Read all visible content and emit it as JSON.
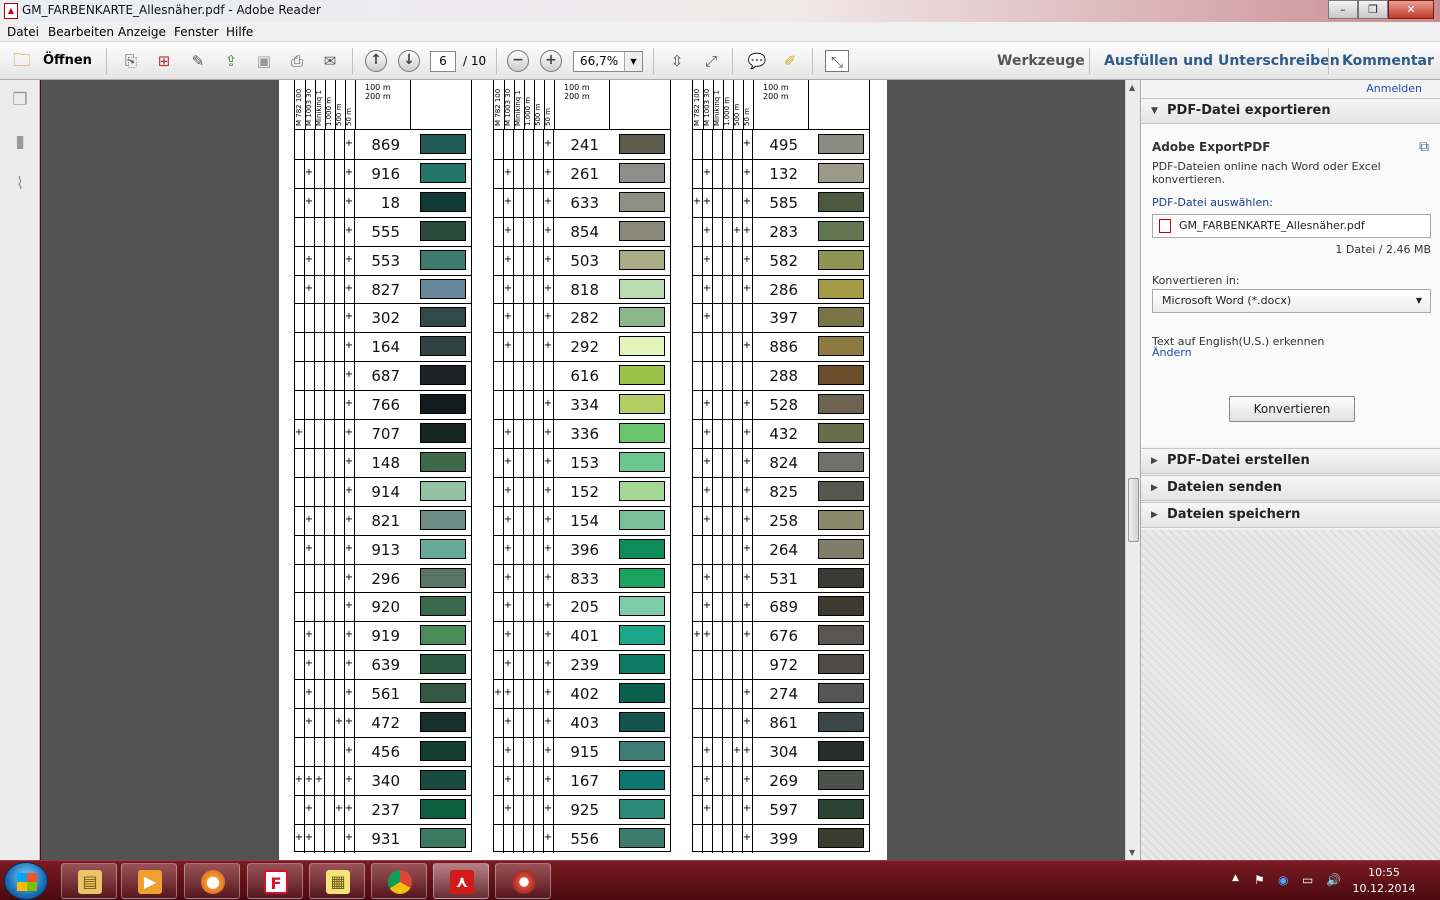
{
  "window": {
    "title": "GM_FARBENKARTE_Allesnäher.pdf - Adobe Reader"
  },
  "menu": [
    "Datei",
    "Bearbeiten",
    "Anzeige",
    "Fenster",
    "Hilfe"
  ],
  "toolbar": {
    "open_label": "Öffnen",
    "page_current": "6",
    "page_total": "/ 10",
    "zoom": "66,7%",
    "tools_label": "Werkzeuge",
    "fill_sign_label": "Ausfüllen und Unterschreiben",
    "comment_label": "Kommentar"
  },
  "document": {
    "column_headers": [
      "M 782 100",
      "M 1003 30",
      "Minikinq 1",
      "1.000 m",
      "500 m",
      "50 m"
    ],
    "meter_labels": [
      "100 m",
      "200 m"
    ],
    "columns": [
      {
        "rows": [
          {
            "num": "869",
            "color": "#1f5a57",
            "marks": [
              0,
              0,
              0,
              0,
              0,
              1
            ]
          },
          {
            "num": "916",
            "color": "#23756a",
            "marks": [
              0,
              1,
              0,
              0,
              0,
              1
            ]
          },
          {
            "num": "18",
            "color": "#0f3a36",
            "marks": [
              0,
              1,
              0,
              0,
              0,
              1
            ]
          },
          {
            "num": "555",
            "color": "#2a4b3e",
            "marks": [
              0,
              0,
              0,
              0,
              0,
              1
            ]
          },
          {
            "num": "553",
            "color": "#3d7b6e",
            "marks": [
              0,
              1,
              0,
              0,
              0,
              1
            ]
          },
          {
            "num": "827",
            "color": "#66889a",
            "marks": [
              0,
              1,
              0,
              0,
              0,
              1
            ]
          },
          {
            "num": "302",
            "color": "#2f4a48",
            "marks": [
              0,
              0,
              0,
              0,
              0,
              1
            ]
          },
          {
            "num": "164",
            "color": "#2f4344",
            "marks": [
              0,
              0,
              0,
              0,
              0,
              1
            ]
          },
          {
            "num": "687",
            "color": "#202326",
            "marks": [
              0,
              0,
              0,
              0,
              0,
              1
            ]
          },
          {
            "num": "766",
            "color": "#131a1d",
            "marks": [
              0,
              0,
              0,
              0,
              0,
              1
            ]
          },
          {
            "num": "707",
            "color": "#172622",
            "marks": [
              1,
              0,
              0,
              0,
              0,
              1
            ]
          },
          {
            "num": "148",
            "color": "#3f6a4a",
            "marks": [
              0,
              0,
              0,
              0,
              0,
              1
            ]
          },
          {
            "num": "914",
            "color": "#92c1a3",
            "marks": [
              0,
              0,
              0,
              0,
              0,
              1
            ]
          },
          {
            "num": "821",
            "color": "#6e8e85",
            "marks": [
              0,
              1,
              0,
              0,
              0,
              1
            ]
          },
          {
            "num": "913",
            "color": "#6aaa98",
            "marks": [
              0,
              1,
              0,
              0,
              0,
              1
            ]
          },
          {
            "num": "296",
            "color": "#587566",
            "marks": [
              0,
              0,
              0,
              0,
              0,
              1
            ]
          },
          {
            "num": "920",
            "color": "#3a6a4c",
            "marks": [
              0,
              0,
              0,
              0,
              0,
              1
            ]
          },
          {
            "num": "919",
            "color": "#4b8c5a",
            "marks": [
              0,
              1,
              0,
              0,
              0,
              1
            ]
          },
          {
            "num": "639",
            "color": "#2d5a43",
            "marks": [
              0,
              1,
              0,
              0,
              0,
              1
            ]
          },
          {
            "num": "561",
            "color": "#375745",
            "marks": [
              0,
              1,
              0,
              0,
              0,
              1
            ]
          },
          {
            "num": "472",
            "color": "#18302b",
            "marks": [
              0,
              1,
              0,
              0,
              1,
              1
            ]
          },
          {
            "num": "456",
            "color": "#113e2e",
            "marks": [
              0,
              0,
              0,
              0,
              0,
              1
            ]
          },
          {
            "num": "340",
            "color": "#1b4a40",
            "marks": [
              1,
              1,
              1,
              0,
              0,
              1
            ]
          },
          {
            "num": "237",
            "color": "#0b5e3f",
            "marks": [
              0,
              1,
              0,
              0,
              1,
              1
            ]
          },
          {
            "num": "931",
            "color": "#3b7963",
            "marks": [
              1,
              1,
              0,
              0,
              0,
              1
            ]
          }
        ]
      },
      {
        "rows": [
          {
            "num": "241",
            "color": "#5e5c4d",
            "marks": [
              0,
              0,
              0,
              0,
              0,
              1
            ]
          },
          {
            "num": "261",
            "color": "#8c8f8a",
            "marks": [
              0,
              1,
              0,
              0,
              0,
              1
            ]
          },
          {
            "num": "633",
            "color": "#8d8f82",
            "marks": [
              0,
              1,
              0,
              0,
              0,
              1
            ]
          },
          {
            "num": "854",
            "color": "#8a8a7a",
            "marks": [
              0,
              1,
              0,
              0,
              0,
              1
            ]
          },
          {
            "num": "503",
            "color": "#a9ad88",
            "marks": [
              0,
              1,
              0,
              0,
              0,
              1
            ]
          },
          {
            "num": "818",
            "color": "#b8dcb0",
            "marks": [
              0,
              1,
              0,
              0,
              0,
              1
            ]
          },
          {
            "num": "282",
            "color": "#8cb78a",
            "marks": [
              0,
              1,
              0,
              0,
              0,
              1
            ]
          },
          {
            "num": "292",
            "color": "#e4f3b9",
            "marks": [
              0,
              1,
              0,
              0,
              0,
              1
            ]
          },
          {
            "num": "616",
            "color": "#9cc24c",
            "marks": [
              0,
              0,
              0,
              0,
              0,
              0
            ]
          },
          {
            "num": "334",
            "color": "#b2cc66",
            "marks": [
              0,
              0,
              0,
              0,
              0,
              1
            ]
          },
          {
            "num": "336",
            "color": "#6ac46d",
            "marks": [
              0,
              1,
              0,
              0,
              0,
              1
            ]
          },
          {
            "num": "153",
            "color": "#6bc68f",
            "marks": [
              0,
              1,
              0,
              0,
              0,
              1
            ]
          },
          {
            "num": "152",
            "color": "#a6d895",
            "marks": [
              0,
              1,
              0,
              0,
              0,
              1
            ]
          },
          {
            "num": "154",
            "color": "#7ac19a",
            "marks": [
              0,
              1,
              0,
              0,
              0,
              1
            ]
          },
          {
            "num": "396",
            "color": "#0b8c58",
            "marks": [
              0,
              1,
              0,
              0,
              0,
              1
            ]
          },
          {
            "num": "833",
            "color": "#1aa35e",
            "marks": [
              0,
              1,
              0,
              0,
              0,
              1
            ]
          },
          {
            "num": "205",
            "color": "#7fccaa",
            "marks": [
              0,
              1,
              0,
              0,
              0,
              1
            ]
          },
          {
            "num": "401",
            "color": "#1da68a",
            "marks": [
              0,
              1,
              0,
              0,
              0,
              1
            ]
          },
          {
            "num": "239",
            "color": "#0b7c62",
            "marks": [
              0,
              1,
              0,
              0,
              0,
              1
            ]
          },
          {
            "num": "402",
            "color": "#0b5f4e",
            "marks": [
              1,
              1,
              0,
              0,
              0,
              1
            ]
          },
          {
            "num": "403",
            "color": "#15534f",
            "marks": [
              0,
              1,
              0,
              0,
              0,
              1
            ]
          },
          {
            "num": "915",
            "color": "#3f7c78",
            "marks": [
              0,
              1,
              0,
              0,
              0,
              1
            ]
          },
          {
            "num": "167",
            "color": "#0e7670",
            "marks": [
              0,
              1,
              0,
              0,
              0,
              1
            ]
          },
          {
            "num": "925",
            "color": "#2a8a76",
            "marks": [
              0,
              1,
              0,
              0,
              0,
              1
            ]
          },
          {
            "num": "556",
            "color": "#3d7d6e",
            "marks": [
              0,
              0,
              0,
              0,
              0,
              1
            ]
          }
        ]
      },
      {
        "rows": [
          {
            "num": "495",
            "color": "#8b8d83",
            "marks": [
              0,
              0,
              0,
              0,
              0,
              1
            ]
          },
          {
            "num": "132",
            "color": "#9b9987",
            "marks": [
              0,
              1,
              0,
              0,
              0,
              1
            ]
          },
          {
            "num": "585",
            "color": "#4c593e",
            "marks": [
              1,
              1,
              0,
              0,
              0,
              1
            ]
          },
          {
            "num": "283",
            "color": "#63764f",
            "marks": [
              0,
              1,
              0,
              0,
              1,
              1
            ]
          },
          {
            "num": "582",
            "color": "#8e9452",
            "marks": [
              0,
              1,
              0,
              0,
              0,
              1
            ]
          },
          {
            "num": "286",
            "color": "#a59a46",
            "marks": [
              0,
              1,
              0,
              0,
              0,
              1
            ]
          },
          {
            "num": "397",
            "color": "#7a7546",
            "marks": [
              0,
              1,
              0,
              0,
              0,
              0
            ]
          },
          {
            "num": "886",
            "color": "#8d7a3e",
            "marks": [
              0,
              0,
              0,
              0,
              0,
              1
            ]
          },
          {
            "num": "288",
            "color": "#6b4d2b",
            "marks": [
              0,
              0,
              0,
              0,
              0,
              0
            ]
          },
          {
            "num": "528",
            "color": "#6e6351",
            "marks": [
              0,
              1,
              0,
              0,
              0,
              1
            ]
          },
          {
            "num": "432",
            "color": "#686e4c",
            "marks": [
              0,
              1,
              0,
              0,
              0,
              1
            ]
          },
          {
            "num": "824",
            "color": "#70716a",
            "marks": [
              0,
              1,
              0,
              0,
              0,
              1
            ]
          },
          {
            "num": "825",
            "color": "#55574e",
            "marks": [
              0,
              1,
              0,
              0,
              0,
              1
            ]
          },
          {
            "num": "258",
            "color": "#8a8a6a",
            "marks": [
              0,
              1,
              0,
              0,
              0,
              1
            ]
          },
          {
            "num": "264",
            "color": "#807d6c",
            "marks": [
              0,
              0,
              0,
              0,
              0,
              1
            ]
          },
          {
            "num": "531",
            "color": "#3a3a36",
            "marks": [
              0,
              1,
              0,
              0,
              0,
              1
            ]
          },
          {
            "num": "689",
            "color": "#3d3b30",
            "marks": [
              0,
              1,
              0,
              0,
              0,
              1
            ]
          },
          {
            "num": "676",
            "color": "#5a5651",
            "marks": [
              1,
              1,
              0,
              0,
              0,
              1
            ]
          },
          {
            "num": "972",
            "color": "#4e4a47",
            "marks": [
              0,
              0,
              0,
              0,
              0,
              0
            ]
          },
          {
            "num": "274",
            "color": "#555555",
            "marks": [
              0,
              0,
              0,
              0,
              0,
              1
            ]
          },
          {
            "num": "861",
            "color": "#3b4746",
            "marks": [
              0,
              0,
              0,
              0,
              0,
              1
            ]
          },
          {
            "num": "304",
            "color": "#282e2b",
            "marks": [
              0,
              1,
              0,
              0,
              1,
              1
            ]
          },
          {
            "num": "269",
            "color": "#4b504b",
            "marks": [
              0,
              1,
              0,
              0,
              0,
              1
            ]
          },
          {
            "num": "597",
            "color": "#2d4333",
            "marks": [
              0,
              1,
              0,
              0,
              0,
              1
            ]
          },
          {
            "num": "399",
            "color": "#3a3d30",
            "marks": [
              0,
              0,
              0,
              0,
              0,
              1
            ]
          }
        ]
      }
    ]
  },
  "panel": {
    "signin": "Anmelden",
    "export_title": "PDF-Datei exportieren",
    "service_title": "Adobe ExportPDF",
    "service_desc_1": "PDF-Dateien online nach Word oder Excel",
    "service_desc_2": "konvertieren.",
    "select_label": "PDF-Datei auswählen:",
    "file_name": "GM_FARBENKARTE_Allesnäher.pdf",
    "file_info": "1 Datei / 2.46 MB",
    "convert_to_label": "Konvertieren in:",
    "convert_to_value": "Microsoft Word (*.docx)",
    "ocr_text": "Text auf English(U.S.) erkennen",
    "change_link": "Ändern",
    "convert_button": "Konvertieren",
    "sections": [
      "PDF-Datei erstellen",
      "Dateien senden",
      "Dateien speichern"
    ]
  },
  "taskbar": {
    "time": "10:55",
    "date": "10.12.2014"
  }
}
